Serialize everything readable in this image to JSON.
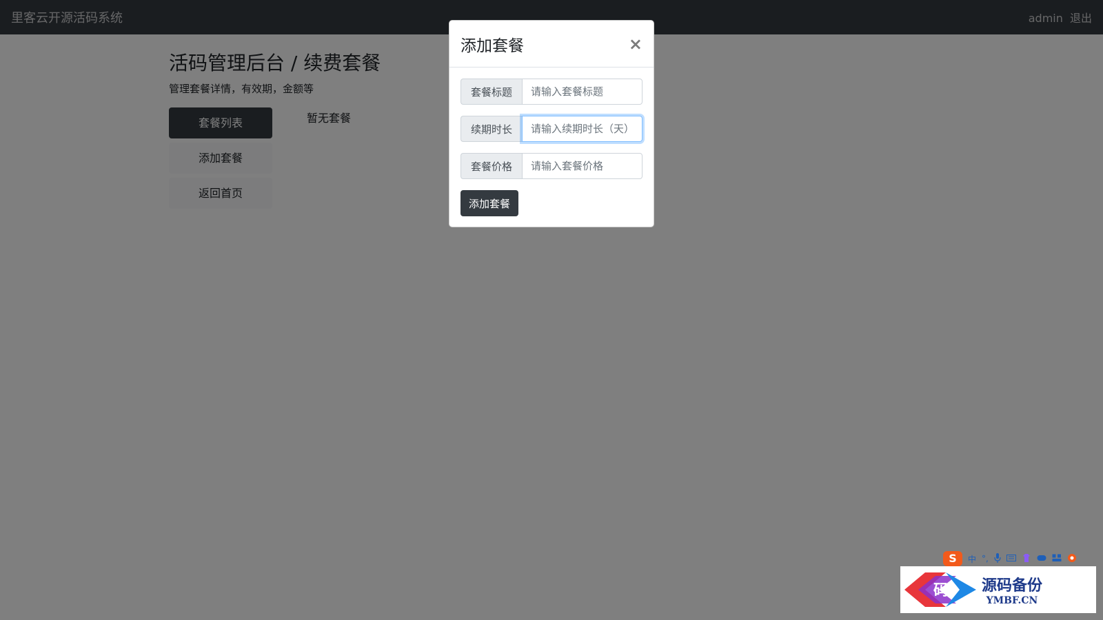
{
  "navbar": {
    "brand": "里客云开源活码系统",
    "user": "admin",
    "logout": "退出"
  },
  "page": {
    "title": "活码管理后台 / 续费套餐",
    "subtitle": "管理套餐详情，有效期，金额等",
    "empty_text": "暂无套餐"
  },
  "sidebar": {
    "items": [
      {
        "label": "套餐列表",
        "active": true
      },
      {
        "label": "添加套餐",
        "active": false
      },
      {
        "label": "返回首页",
        "active": false
      }
    ]
  },
  "modal": {
    "title": "添加套餐",
    "close": "×",
    "fields": [
      {
        "label": "套餐标题",
        "placeholder": "请输入套餐标题",
        "value": ""
      },
      {
        "label": "续期时长",
        "placeholder": "请输入续期时长（天）",
        "value": ""
      },
      {
        "label": "套餐价格",
        "placeholder": "请输入套餐价格",
        "value": ""
      }
    ],
    "submit_label": "添加套餐"
  },
  "ime_toolbar": {
    "logo": "S",
    "mode": "中",
    "icons": [
      "punctuation-icon",
      "microphone-icon",
      "keyboard-icon",
      "skin-icon",
      "gamepad-icon",
      "toolbox-icon",
      "settings-icon"
    ]
  },
  "watermark": {
    "logo_char": "码",
    "main": "源码备份",
    "sub": "YMBF.CN"
  },
  "colors": {
    "navbar": "#343a40",
    "primary_dark": "#343a40",
    "focus_ring": "#80bdff"
  }
}
